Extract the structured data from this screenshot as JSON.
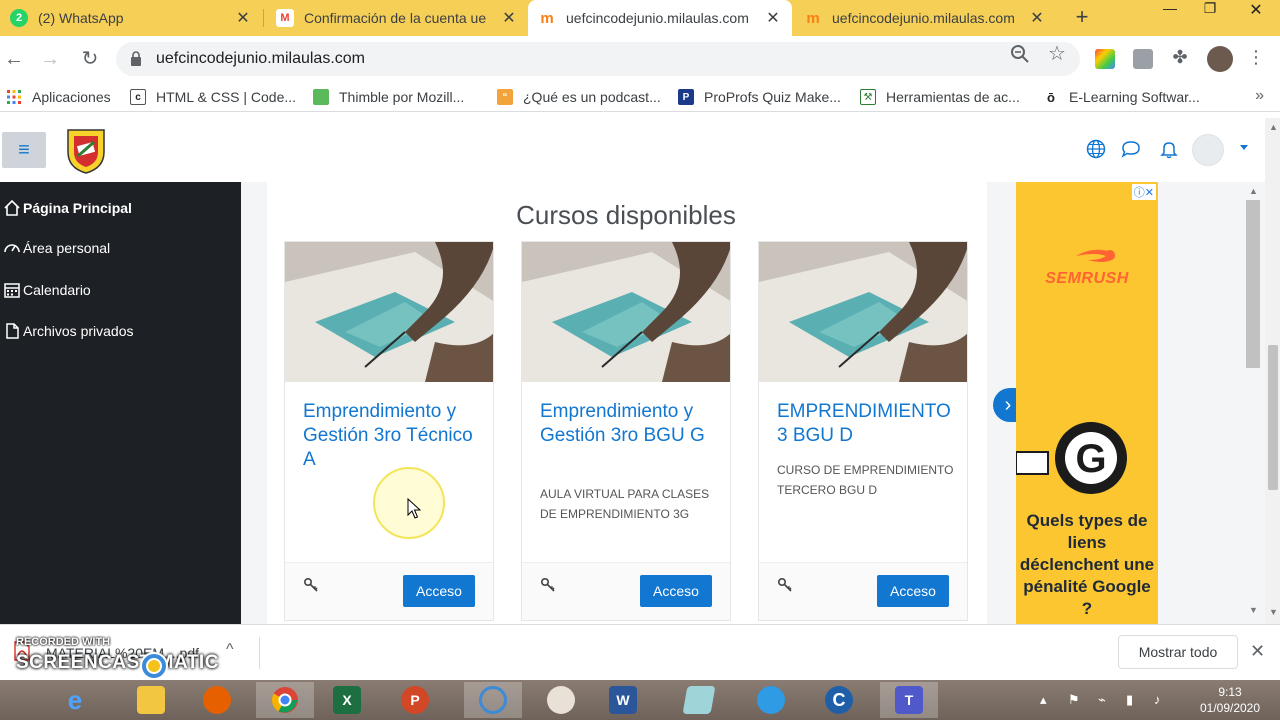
{
  "browser": {
    "tabs": [
      {
        "title": "(2) WhatsApp",
        "fav": "2",
        "fav_color": "#25d366"
      },
      {
        "title": "Confirmación de la cuenta ue",
        "fav": "M",
        "fav_color": "#ea4335"
      },
      {
        "title": "uefcincodejunio.milaulas.com",
        "fav": "m",
        "fav_color": "#f98012"
      },
      {
        "title": "uefcincodejunio.milaulas.com",
        "fav": "m",
        "fav_color": "#f98012"
      }
    ],
    "url": "uefcincodejunio.milaulas.com",
    "bookmarks": [
      {
        "label": "Aplicaciones",
        "icon": "apps-grid-icon"
      },
      {
        "label": "HTML & CSS | Code...",
        "icon": "c"
      },
      {
        "label": "Thimble por Mozill...",
        "icon": "thimble"
      },
      {
        "label": "¿Qué es un podcast...",
        "icon": "quote"
      },
      {
        "label": "ProProfs Quiz Make...",
        "icon": "P"
      },
      {
        "label": "Herramientas de ac...",
        "icon": "tools"
      },
      {
        "label": "E-Learning Softwar...",
        "icon": "o"
      }
    ]
  },
  "sidebar": {
    "items": [
      {
        "label": "Página Principal",
        "icon": "home-icon"
      },
      {
        "label": "Área personal",
        "icon": "dashboard-icon"
      },
      {
        "label": "Calendario",
        "icon": "calendar-icon"
      },
      {
        "label": "Archivos privados",
        "icon": "file-icon"
      }
    ]
  },
  "main": {
    "section_title": "Cursos disponibles",
    "courses": [
      {
        "name": "Emprendimiento y Gestión 3ro Técnico A",
        "summary": "",
        "button": "Acceso"
      },
      {
        "name": "Emprendimiento y Gestión 3ro BGU G",
        "summary": "AULA VIRTUAL PARA CLASES DE EMPRENDIMIENTO 3G",
        "button": "Acceso"
      },
      {
        "name": "EMPRENDIMIENTO 3 BGU D",
        "summary": "CURSO DE EMPRENDIMIENTO TERCERO BGU D",
        "button": "Acceso"
      }
    ]
  },
  "ad": {
    "brand": "SEMRUSH",
    "text": "Quels types de liens déclenchent une pénalité Google ?"
  },
  "download": {
    "file": "MATERIAL%20EM....pdf",
    "show_all": "Mostrar todo"
  },
  "watermark": {
    "small": "RECORDED WITH",
    "big": "SCREENCAST   MATIC"
  },
  "clock": {
    "time": "9:13",
    "date": "01/09/2020"
  },
  "colors": {
    "moodle_blue": "#1177d1",
    "sidebar_bg": "#1d2125",
    "tabstrip": "#f6cf57"
  }
}
